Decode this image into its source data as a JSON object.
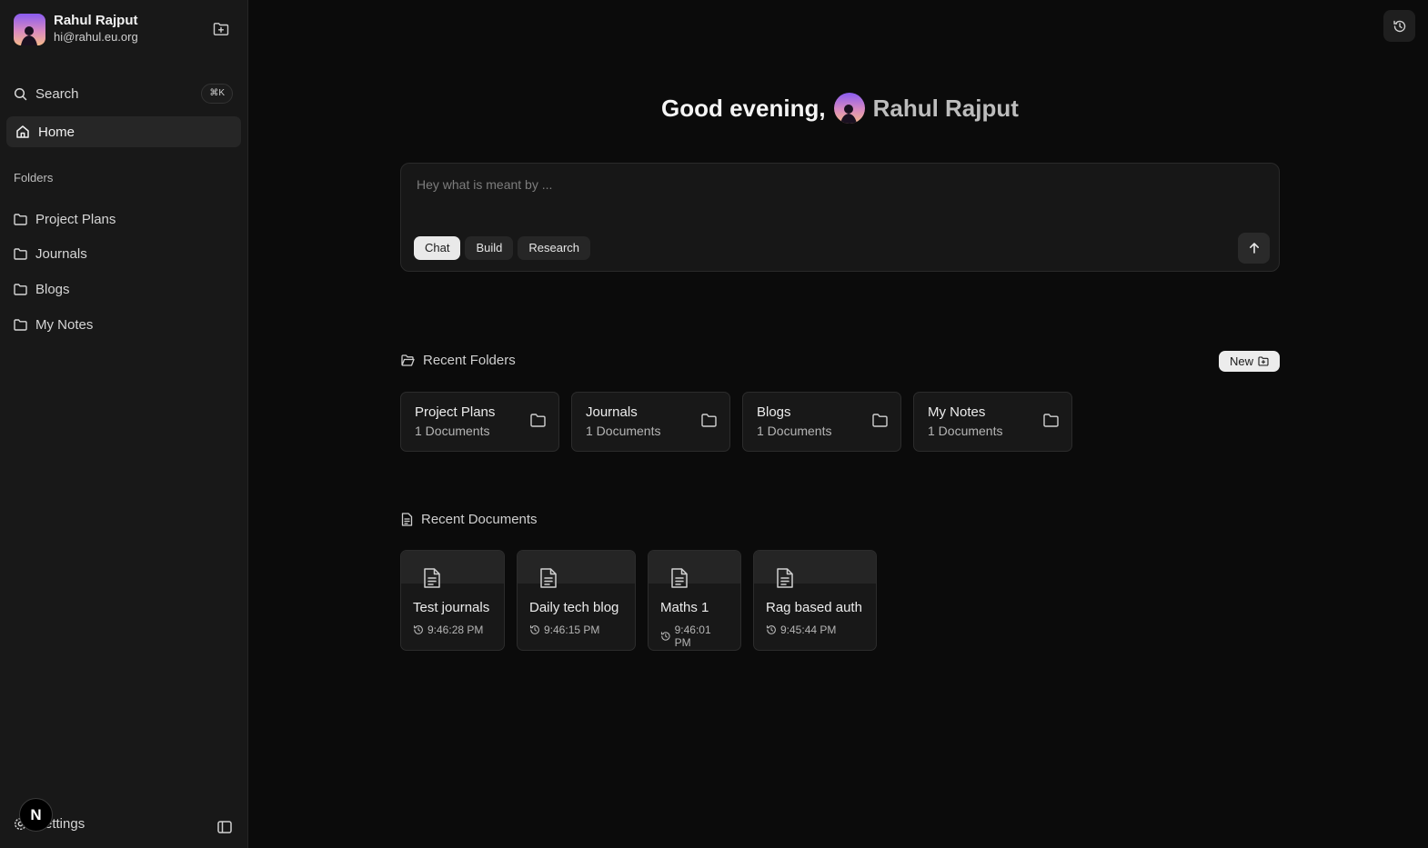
{
  "user": {
    "name": "Rahul Rajput",
    "email": "hi@rahul.eu.org"
  },
  "sidebar": {
    "search_label": "Search",
    "search_shortcut": "⌘K",
    "home_label": "Home",
    "folders_heading": "Folders",
    "folders": [
      {
        "label": "Project Plans"
      },
      {
        "label": "Journals"
      },
      {
        "label": "Blogs"
      },
      {
        "label": "My Notes"
      }
    ],
    "settings_label": "Settings",
    "badge_letter": "N"
  },
  "greeting": {
    "prefix": "Good evening,",
    "name": "Rahul Rajput"
  },
  "chat": {
    "placeholder": "Hey what is meant by ...",
    "modes": [
      {
        "label": "Chat",
        "active": true
      },
      {
        "label": "Build",
        "active": false
      },
      {
        "label": "Research",
        "active": false
      }
    ]
  },
  "recent_folders": {
    "heading": "Recent Folders",
    "new_label": "New",
    "items": [
      {
        "name": "Project Plans",
        "count": "1 Documents"
      },
      {
        "name": "Journals",
        "count": "1 Documents"
      },
      {
        "name": "Blogs",
        "count": "1 Documents"
      },
      {
        "name": "My Notes",
        "count": "1 Documents"
      }
    ]
  },
  "recent_documents": {
    "heading": "Recent Documents",
    "items": [
      {
        "title": "Test journals",
        "time": "9:46:28 PM"
      },
      {
        "title": "Daily tech blog",
        "time": "9:46:15 PM"
      },
      {
        "title": "Maths 1",
        "time": "9:46:01 PM"
      },
      {
        "title": "Rag based auth",
        "time": "9:45:44 PM"
      }
    ]
  },
  "colors": {
    "background": "#0b0b0b",
    "sidebar": "#181818",
    "accent_light": "#ececec"
  }
}
